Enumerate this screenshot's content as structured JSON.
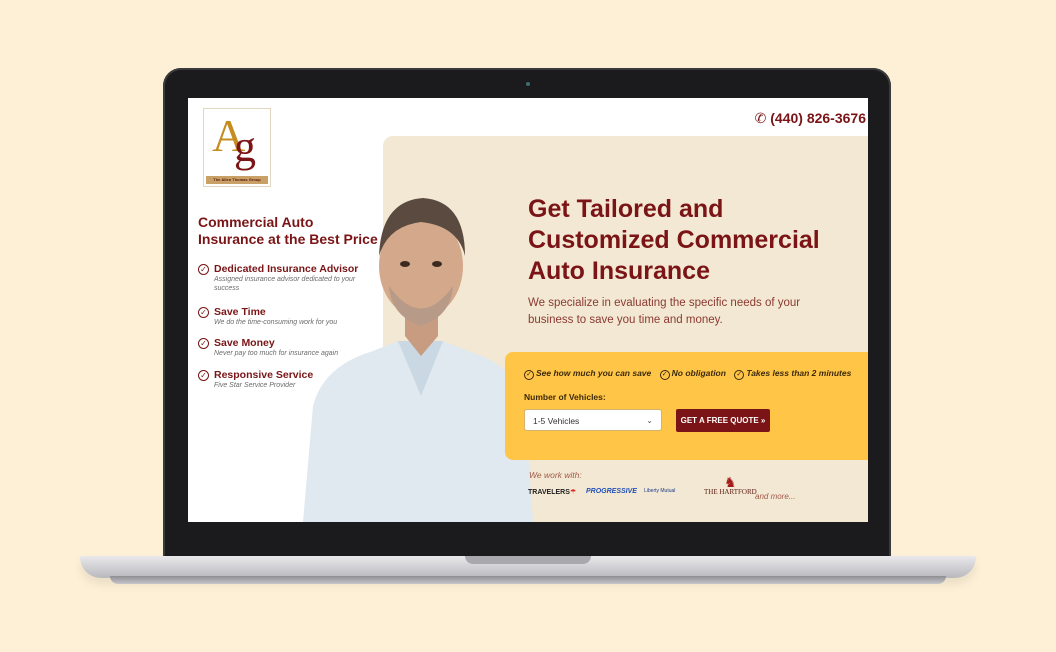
{
  "header": {
    "logo_caption": "The Allen Thomas Group",
    "phone": "(440) 826-3676"
  },
  "left": {
    "title": "Commercial Auto Insurance at the Best Price",
    "benefits": [
      {
        "title": "Dedicated Insurance Advisor",
        "desc": "Assigned insurance advisor dedicated to your success"
      },
      {
        "title": "Save Time",
        "desc": "We do the time-consuming work for you"
      },
      {
        "title": "Save Money",
        "desc": "Never pay too much for insurance again"
      },
      {
        "title": "Responsive Service",
        "desc": "Five Star Service Provider"
      }
    ]
  },
  "hero": {
    "headline": "Get Tailored and Customized Commercial Auto Insurance",
    "subtext": "We specialize in evaluating the specific needs of your business to save you time and money."
  },
  "quote": {
    "perks": [
      "See how much you can save",
      "No obligation",
      "Takes less than 2 minutes"
    ],
    "vehicles_label": "Number of Vehicles:",
    "vehicles_value": "1-5 Vehicles",
    "button_label": "GET A FREE QUOTE »"
  },
  "partners": {
    "label": "We work with:",
    "brands": [
      "TRAVELERS",
      "PROGRESSIVE",
      "Liberty Mutual",
      "THE HARTFORD"
    ],
    "more": "and more..."
  },
  "colors": {
    "brand": "#7a1416",
    "accent": "#ffc547",
    "hero_bg": "#f3e8d3",
    "page_bg": "#fdf0d6"
  }
}
